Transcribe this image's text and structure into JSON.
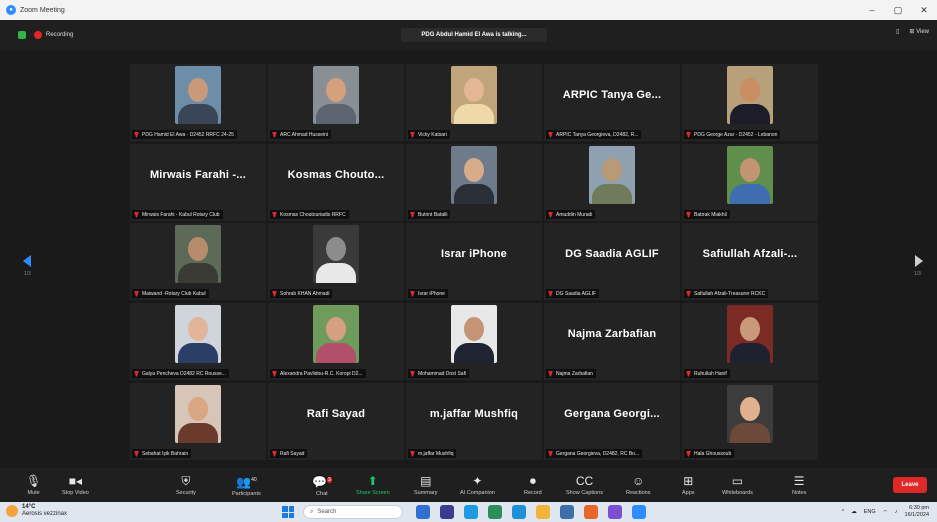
{
  "window": {
    "title": "Zoom Meeting",
    "min": "–",
    "max": "▢",
    "close": "✕"
  },
  "topbar": {
    "recording": "Recording",
    "talking": "PDG Abdul Hamid El Awa is talking...",
    "view": "View"
  },
  "navigation": {
    "left_page": "1/3",
    "right_page": "1/3"
  },
  "tiles": [
    {
      "label": "PDG Hamid El Awa - D2452 RRFC 24-25",
      "name": "",
      "photo": {
        "bg": "#6e8da8",
        "skin": "#c99a7a",
        "shirt": "#3a4656"
      }
    },
    {
      "label": "ARC Ahmad Husseini",
      "name": "",
      "photo": {
        "bg": "#8a8f96",
        "skin": "#d4a17c",
        "shirt": "#5c6470"
      }
    },
    {
      "label": "Vicky Katsari",
      "name": "",
      "photo": {
        "bg": "#c0a47a",
        "skin": "#e3b796",
        "shirt": "#f0d9a8"
      }
    },
    {
      "label": "ARPIC Tanya Georgieva, D2482, R...",
      "name": "ARPIC Tanya Ge...",
      "photo": null
    },
    {
      "label": "PDG George Azar - D2452 - Lebanon",
      "name": "",
      "photo": {
        "bg": "#b7a07a",
        "skin": "#c98e62",
        "shirt": "#1d1d2a"
      }
    },
    {
      "label": "Mirwais Farahi - Kabul Rotary Club",
      "name": "Mirwais Farahi -...",
      "photo": null
    },
    {
      "label": "Kosmas Choutouriadis RRFC",
      "name": "Kosmas Chouto...",
      "photo": null
    },
    {
      "label": "Butrint Batalli",
      "name": "",
      "photo": {
        "bg": "#6d7b8a",
        "skin": "#d8ab8a",
        "shirt": "#2a2f38"
      }
    },
    {
      "label": "Amuddin Muradi",
      "name": "",
      "photo": {
        "bg": "#8fa1b0",
        "skin": "#b99a76",
        "shirt": "#6f7b5a"
      }
    },
    {
      "label": "Babrak Miakhil",
      "name": "",
      "photo": {
        "bg": "#5f8f4a",
        "skin": "#c29470",
        "shirt": "#3e6db0"
      }
    },
    {
      "label": "Maiwand -Rotary Club Kabul",
      "name": "",
      "photo": {
        "bg": "#5e6a58",
        "skin": "#b68d6c",
        "shirt": "#3b3b36"
      }
    },
    {
      "label": "Sohrab KHAN Ahmadi",
      "name": "",
      "photo": {
        "bg": "#3a3a3a",
        "skin": "#8c8c8c",
        "shirt": "#e8e8e8"
      }
    },
    {
      "label": "Israr iPhone",
      "name": "Israr iPhone",
      "photo": null
    },
    {
      "label": "DG Saadia AGLIF",
      "name": "DG Saadia AGLIF",
      "photo": null
    },
    {
      "label": "Safiullah Afzali-Treasurer RCKC",
      "name": "Safiullah Afzali-...",
      "photo": null
    },
    {
      "label": "Galya Pencheva D2482 RC Rousse...",
      "name": "",
      "photo": {
        "bg": "#cfd5da",
        "skin": "#e2b59a",
        "shirt": "#2b3f66"
      }
    },
    {
      "label": "Alexandra Pavlidou-R.C. Koropi D2...",
      "name": "",
      "photo": {
        "bg": "#6f9b5c",
        "skin": "#d4a080",
        "shirt": "#b24f6a"
      }
    },
    {
      "label": "Mohammad Dost Safi",
      "name": "",
      "photo": {
        "bg": "#e8e8e8",
        "skin": "#c49474",
        "shirt": "#1f2430"
      }
    },
    {
      "label": "Najma Zarbafian",
      "name": "Najma Zarbafian",
      "photo": null
    },
    {
      "label": "Ruhullah Hanif",
      "name": "",
      "photo": {
        "bg": "#7b2a24",
        "skin": "#c99a7a",
        "shirt": "#1e2230"
      }
    },
    {
      "label": "Sebahat Ișik Bahrain",
      "name": "",
      "photo": {
        "bg": "#d7c6b8",
        "skin": "#d9a784",
        "shirt": "#6a3b2c"
      }
    },
    {
      "label": "Rafi Sayad",
      "name": "Rafi Sayad",
      "photo": null
    },
    {
      "label": "m.jaffar Mushfiq",
      "name": "m.jaffar Mushfiq",
      "photo": null
    },
    {
      "label": "Gergana Georgieva, D2482, RC Bo...",
      "name": "Gergana Georgi...",
      "photo": null
    },
    {
      "label": "Hala Ghoussoub",
      "name": "",
      "photo": {
        "bg": "#3c3c3c",
        "skin": "#e0b08f",
        "shirt": "#6b4a3a"
      }
    }
  ],
  "toolbar": {
    "mute": "Mute",
    "stop_video": "Stop Video",
    "security": "Security",
    "participants": "Participants",
    "participants_count": "40",
    "chat": "Chat",
    "chat_badge": "3",
    "share": "Share Screen",
    "summary": "Summary",
    "ai": "AI Companion",
    "record": "Record",
    "captions": "Show Captions",
    "reactions": "Reactions",
    "apps": "Apps",
    "whiteboards": "Whiteboards",
    "notes": "Notes",
    "leave": "Leave"
  },
  "taskbar": {
    "temp": "14°C",
    "weather": "Aerosis vezzinax",
    "search": "Search",
    "lang": "ENG",
    "time": "6:30 pm",
    "date": "16/1/2024"
  }
}
